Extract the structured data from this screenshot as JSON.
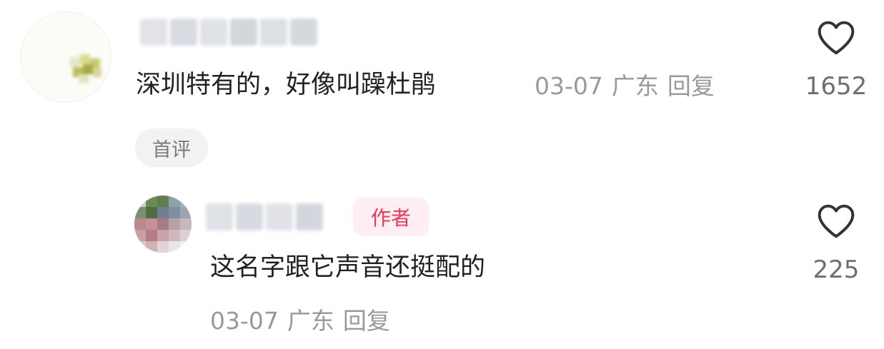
{
  "comment": {
    "text": "深圳特有的，好像叫躁杜鹃",
    "date": "03-07",
    "location": "广东",
    "reply_label": "回复",
    "tag": "首评",
    "like_count": "1652",
    "like_icon": "heart-outline-icon"
  },
  "reply": {
    "badge": "作者",
    "text": "这名字跟它声音还挺配的",
    "date": "03-07",
    "location": "广东",
    "reply_label": "回复",
    "like_count": "225",
    "like_icon": "heart-outline-icon"
  },
  "colors": {
    "text_primary": "#222222",
    "text_meta": "#999999",
    "badge_text": "#ee3856",
    "badge_bg": "#fdeff1",
    "tag_bg": "#f2f2f2"
  }
}
